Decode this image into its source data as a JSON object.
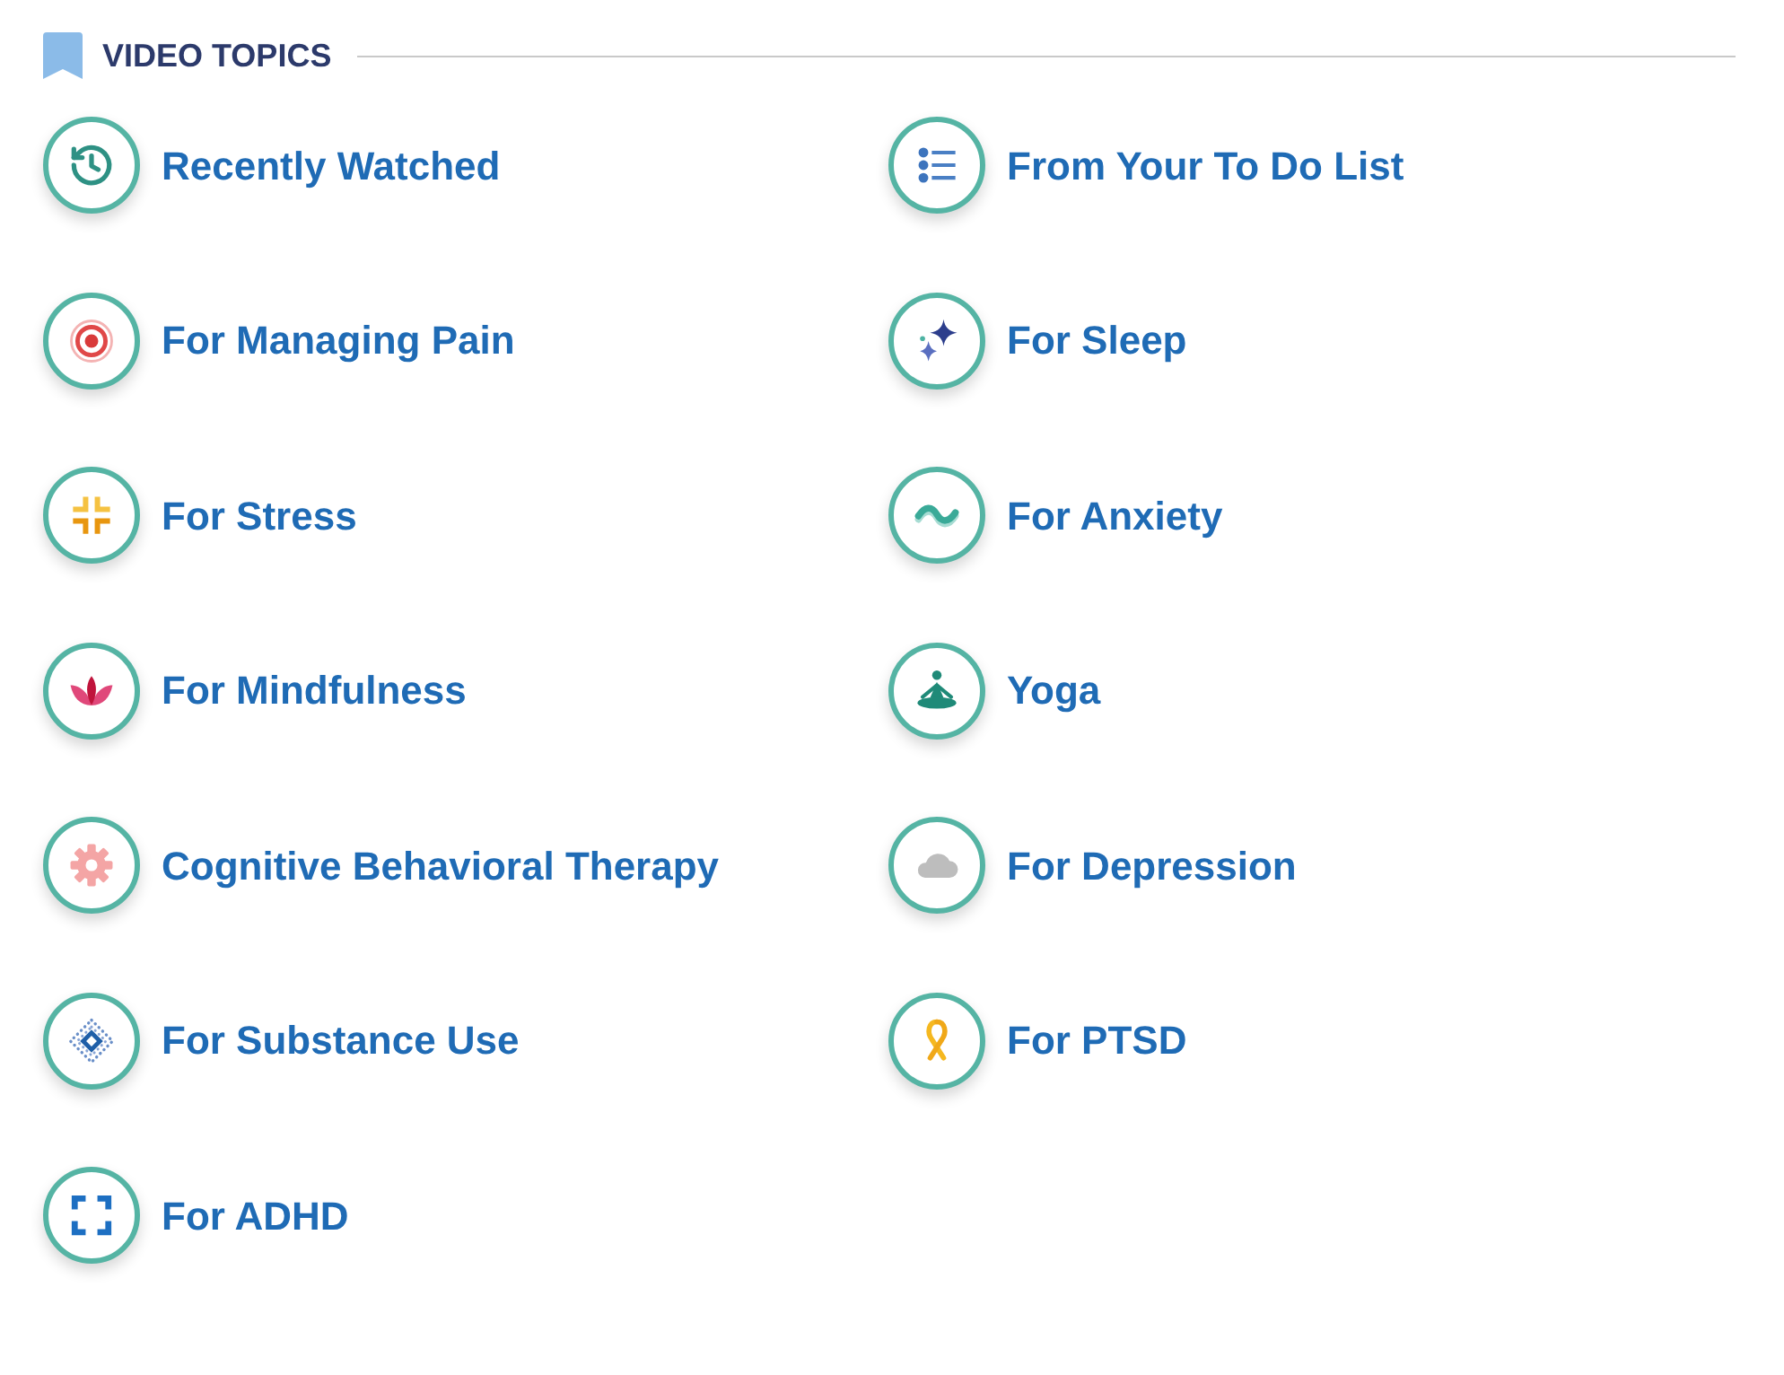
{
  "header": {
    "title": "VIDEO TOPICS"
  },
  "topics": [
    {
      "label": "Recently Watched",
      "kind": "history"
    },
    {
      "label": "From Your To Do List",
      "kind": "list"
    },
    {
      "label": "For Managing Pain",
      "kind": "target"
    },
    {
      "label": "For Sleep",
      "kind": "sparkles"
    },
    {
      "label": "For Stress",
      "kind": "shrink"
    },
    {
      "label": "For Anxiety",
      "kind": "wave"
    },
    {
      "label": "For Mindfulness",
      "kind": "lotus"
    },
    {
      "label": "Yoga",
      "kind": "yoga"
    },
    {
      "label": "Cognitive Behavioral Therapy",
      "kind": "gear"
    },
    {
      "label": "For Depression",
      "kind": "cloud"
    },
    {
      "label": "For Substance Use",
      "kind": "diamond"
    },
    {
      "label": "For PTSD",
      "kind": "ribbon"
    },
    {
      "label": "For ADHD",
      "kind": "focus"
    }
  ]
}
